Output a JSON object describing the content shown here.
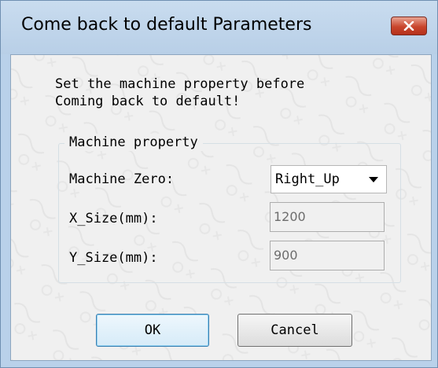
{
  "dialog": {
    "title": "Come back to default Parameters",
    "close_icon": "close-x-icon"
  },
  "message": {
    "line1": "Set the machine property before",
    "line2": "Coming back to default!"
  },
  "machine_property": {
    "group_title": "Machine property",
    "machine_zero": {
      "label": "Machine Zero:",
      "selected": "Right_Up"
    },
    "x_size": {
      "label": "X_Size(mm):",
      "value": "1200"
    },
    "y_size": {
      "label": "Y_Size(mm):",
      "value": "900"
    }
  },
  "buttons": {
    "ok_label": "OK",
    "cancel_label": "Cancel"
  },
  "colors": {
    "titlebar": "#b9d1ea",
    "close_button": "#c9452c",
    "dialog_background": "#f0f0f0",
    "default_button_border": "#3c7fb1"
  }
}
